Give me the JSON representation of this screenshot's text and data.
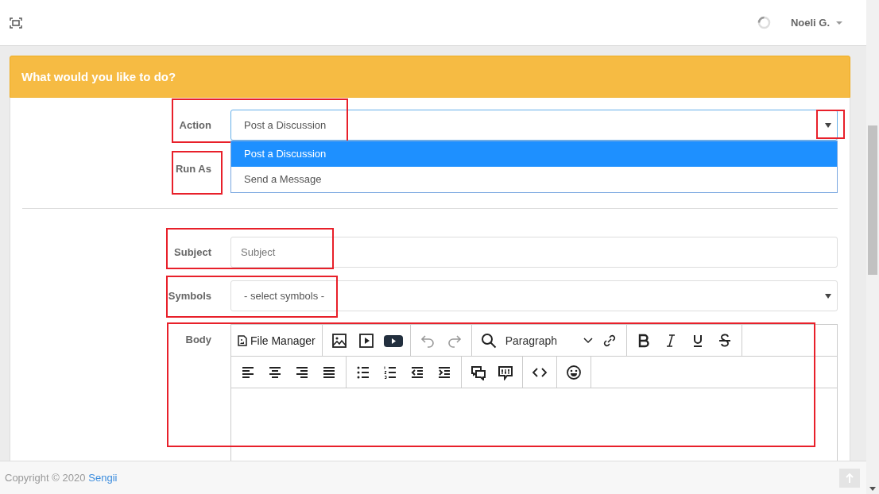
{
  "topbar": {
    "user": "Noeli G."
  },
  "panel": {
    "title": "What would you like to do?"
  },
  "form": {
    "action": {
      "label": "Action",
      "value": "Post a Discussion",
      "expanded": true,
      "options": [
        {
          "label": "Post a Discussion",
          "selected": true
        },
        {
          "label": "Send a Message",
          "selected": false
        }
      ]
    },
    "run_as": {
      "label": "Run As"
    },
    "subject": {
      "label": "Subject",
      "placeholder": "Subject"
    },
    "symbols": {
      "label": "Symbols",
      "value": "- select symbols -"
    },
    "body": {
      "label": "Body",
      "file_manager": "File Manager",
      "block_format": "Paragraph"
    }
  },
  "footer": {
    "copyright": "Copyright © 2020",
    "link": "Sengii"
  }
}
